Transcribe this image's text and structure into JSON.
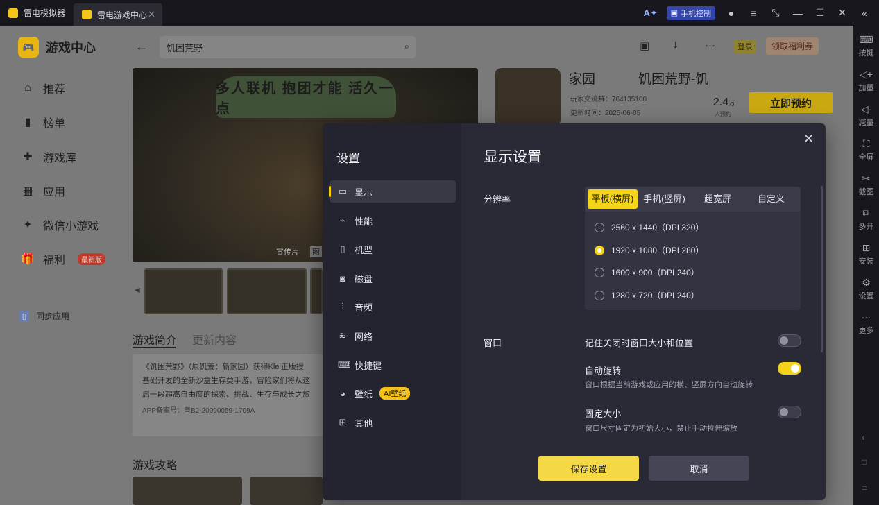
{
  "titlebar": {
    "tabs": [
      {
        "label": "雷电模拟器"
      },
      {
        "label": "雷电游戏中心"
      }
    ],
    "phone_control": "手机控制"
  },
  "right_toolbar": {
    "items": [
      {
        "label": "按键",
        "icon": "keyboard-icon"
      },
      {
        "label": "加量",
        "icon": "volume-up-icon"
      },
      {
        "label": "减量",
        "icon": "volume-down-icon"
      },
      {
        "label": "全屏",
        "icon": "fullscreen-icon"
      },
      {
        "label": "截图",
        "icon": "scissors-icon"
      },
      {
        "label": "多开",
        "icon": "multi-instance-icon"
      },
      {
        "label": "安装",
        "icon": "apk-install-icon"
      },
      {
        "label": "设置",
        "icon": "gear-icon"
      },
      {
        "label": "更多",
        "icon": "more-icon"
      }
    ]
  },
  "sidebar": {
    "brand": "游戏中心",
    "items": [
      {
        "label": "推荐"
      },
      {
        "label": "榜单"
      },
      {
        "label": "游戏库"
      },
      {
        "label": "应用"
      },
      {
        "label": "微信小游戏"
      },
      {
        "label": "福利",
        "badge": "最新版"
      }
    ],
    "sync": "同步应用"
  },
  "header": {
    "search_value": "饥困荒野",
    "login": "登录",
    "coupon": "领取福利券"
  },
  "game": {
    "title_left": "家园",
    "title_right": "饥困荒野-饥",
    "group": "玩家交流群：764135100",
    "updated": "更新时间：2025-06-05",
    "count": "2.4",
    "count_unit": "万",
    "count_label": "人预约",
    "reserve": "立即预约",
    "banner_text": "多人联机 抱团才能 活久一点",
    "banner_tag": "宣传片",
    "banner_tag2": "图"
  },
  "content": {
    "tab_intro": "游戏简介",
    "tab_update": "更新内容",
    "desc_lines": [
      "《饥困荒野》（原饥荒：新家园）获得Klei正版授",
      "基础开发的全新沙盒生存类手游，冒险家们将从这",
      "启一段超高自由度的探索、挑战、生存与成长之旅"
    ],
    "record": "APP备案号：粤B2-20090059-1709A",
    "guide_title": "游戏攻略"
  },
  "settings": {
    "title": "设置",
    "nav": [
      {
        "label": "显示",
        "icon": "monitor-icon"
      },
      {
        "label": "性能",
        "icon": "performance-icon"
      },
      {
        "label": "机型",
        "icon": "phone-icon"
      },
      {
        "label": "磁盘",
        "icon": "disk-icon"
      },
      {
        "label": "音频",
        "icon": "audio-icon"
      },
      {
        "label": "网络",
        "icon": "wifi-icon"
      },
      {
        "label": "快捷键",
        "icon": "keyboard-icon"
      },
      {
        "label": "壁纸",
        "icon": "palette-icon",
        "badge": "AI壁纸"
      },
      {
        "label": "其他",
        "icon": "grid-icon"
      }
    ],
    "section_title": "显示设置",
    "resolution_label": "分辨率",
    "resolution_tabs": [
      "平板(横屏)",
      "手机(竖屏)",
      "超宽屏",
      "自定义"
    ],
    "resolutions": [
      "2560 x 1440（DPI 320）",
      "1920 x 1080（DPI 280）",
      "1600 x 900（DPI 240）",
      "1280 x 720（DPI 240）"
    ],
    "selected_resolution": 1,
    "window_label": "窗口",
    "remember_window": "记住关闭时窗口大小和位置",
    "remember_window_on": false,
    "auto_rotate": "自动旋转",
    "auto_rotate_hint": "窗口根据当前游戏或应用的横、竖屏方向自动旋转",
    "auto_rotate_on": true,
    "fixed_size": "固定大小",
    "fixed_size_hint": "窗口尺寸固定为初始大小，禁止手动拉伸缩放",
    "fixed_size_on": false,
    "save": "保存设置",
    "cancel": "取消"
  },
  "colors": {
    "accent": "#f5d21a",
    "modal_bg": "#2a2a37"
  }
}
